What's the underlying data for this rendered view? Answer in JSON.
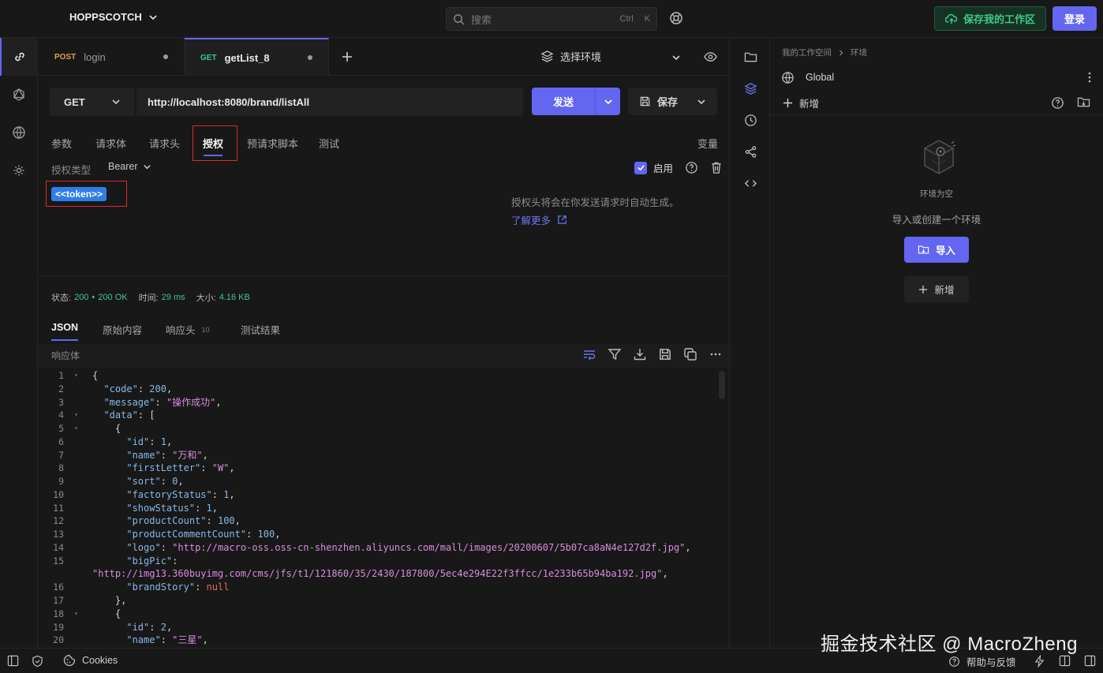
{
  "app": {
    "brand": "HOPPSCOTCH"
  },
  "search": {
    "placeholder": "搜索",
    "kbd1": "Ctrl",
    "kbd2": "K"
  },
  "header": {
    "save_workspace": "保存我的工作区",
    "login": "登录"
  },
  "tabs": [
    {
      "method": "POST",
      "name": "login",
      "method_color": "#e0a14b"
    },
    {
      "method": "GET",
      "name": "getList_8",
      "method_color": "#3fc88a"
    }
  ],
  "env_select": {
    "label": "选择环境"
  },
  "request": {
    "method": "GET",
    "url": "http://localhost:8080/brand/listAll",
    "send_label": "发送",
    "save_label": "保存"
  },
  "subtabs": {
    "params": "参数",
    "body": "请求体",
    "headers": "请求头",
    "auth": "授权",
    "prescript": "预请求脚本",
    "tests": "测试",
    "variables": "变量"
  },
  "auth": {
    "type_label": "授权类型",
    "type_value": "Bearer",
    "enabled_label": "启用",
    "token": "<<token>>",
    "info": "授权头将会在你发送请求时自动生成。",
    "learn_more": "了解更多"
  },
  "status": {
    "status_label": "状态:",
    "code": "200",
    "bullet": "•",
    "text": "200 OK",
    "time_label": "时间:",
    "time": "29 ms",
    "size_label": "大小:",
    "size": "4.16 KB"
  },
  "response_tabs": {
    "json": "JSON",
    "raw": "原始内容",
    "headers": "响应头",
    "headers_count": "10",
    "tests": "测试结果"
  },
  "response": {
    "body_label": "响应体"
  },
  "code": {
    "line_numbers": [
      "1",
      "2",
      "3",
      "4",
      "5",
      "6",
      "7",
      "8",
      "9",
      "10",
      "11",
      "12",
      "13",
      "14",
      "15",
      "",
      "16",
      "17",
      "18",
      "19",
      "20"
    ],
    "folds": [
      "▾",
      "",
      "",
      "▾",
      "▾",
      "",
      "",
      "",
      "",
      "",
      "",
      "",
      "",
      "",
      "",
      "",
      "",
      "",
      "▾",
      "",
      ""
    ],
    "lines": [
      "{",
      "  \"code\": 200,",
      "  \"message\": \"操作成功\",",
      "  \"data\": [",
      "    {",
      "      \"id\": 1,",
      "      \"name\": \"万和\",",
      "      \"firstLetter\": \"W\",",
      "      \"sort\": 0,",
      "      \"factoryStatus\": 1,",
      "      \"showStatus\": 1,",
      "      \"productCount\": 100,",
      "      \"productCommentCount\": 100,",
      "      \"logo\": \"http://macro-oss.oss-cn-shenzhen.aliyuncs.com/mall/images/20200607/5b07ca8aN4e127d2f.jpg\",",
      "      \"bigPic\":",
      "\"http://img13.360buyimg.com/cms/jfs/t1/121860/35/2430/187800/5ec4e294E22f3ffcc/1e233b65b94ba192.jpg\",",
      "      \"brandStory\": null",
      "    },",
      "    {",
      "      \"id\": 2,",
      "      \"name\": \"三星\","
    ]
  },
  "right_panel": {
    "crumb_workspace": "我的工作空间",
    "crumb_env": "环境",
    "global": "Global",
    "new_label": "新增",
    "empty_title": "环境为空",
    "empty_sub": "导入或创建一个环境",
    "import_label": "导入",
    "new_btn": "新增"
  },
  "bottom": {
    "cookies": "Cookies",
    "help": "帮助与反馈"
  },
  "watermark": "掘金技术社区 @ MacroZheng",
  "colors": {
    "accent": "#6366f1",
    "success": "#3fc88a",
    "string": "#d98be0",
    "key": "#86b8e8",
    "highlight": "#e0282e"
  }
}
